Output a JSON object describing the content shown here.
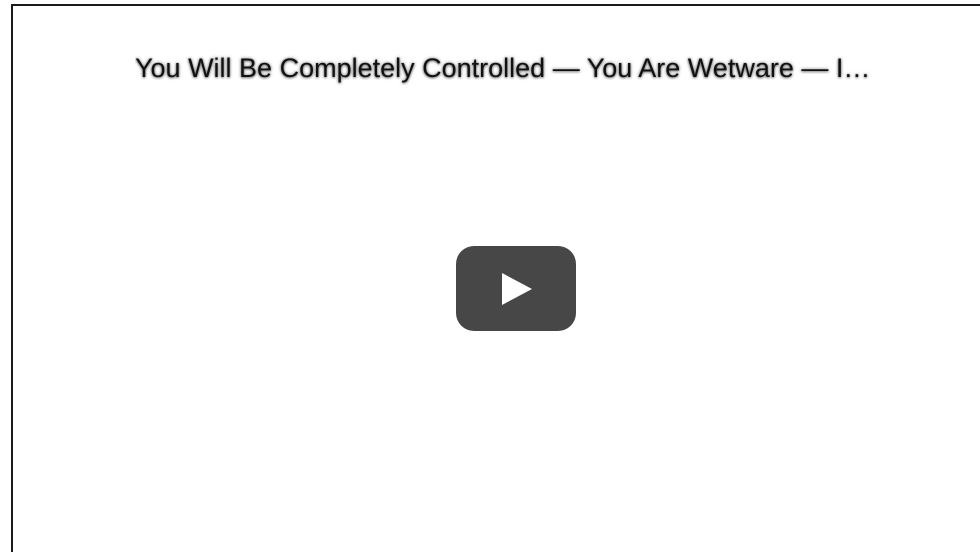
{
  "video": {
    "title": "You Will Be Completely Controlled — You Are Wetware — I…",
    "play_icon": "play-icon",
    "play_button_color": "#474747"
  }
}
